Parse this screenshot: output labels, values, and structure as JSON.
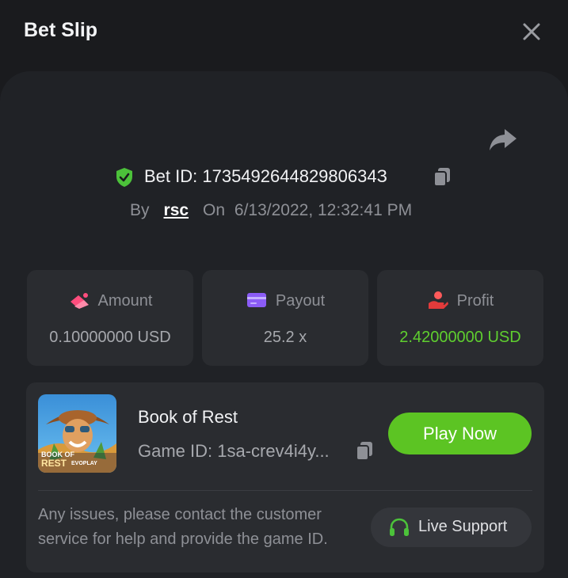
{
  "header": {
    "title": "Bet Slip"
  },
  "bet": {
    "id_text": "Bet ID: 173549264482980634З",
    "by_label": "By",
    "user": "rsc",
    "on_label": "On",
    "datetime": "6/13/2022, 12:32:41 PM"
  },
  "stats": {
    "amount": {
      "label": "Amount",
      "value": "0.10000000 USD",
      "icon": "coins-icon",
      "color": "#ff4d7d"
    },
    "payout": {
      "label": "Payout",
      "value": "25.2 x",
      "icon": "card-icon",
      "color": "#8b5cf6"
    },
    "profit": {
      "label": "Profit",
      "value": "2.42000000 USD",
      "icon": "hand-coin-icon",
      "color": "#5fcf2f"
    }
  },
  "game": {
    "name": "Book of Rest",
    "id_text": "Game ID: 1sa-crev4i4y...",
    "thumb_text_1": "BOOK OF",
    "thumb_text_2": "REST",
    "thumb_brand": "EVOPLAY",
    "play_label": "Play Now",
    "issues_text": "Any issues, please contact the customer service for help and provide the game ID.",
    "support_label": "Live Support"
  },
  "colors": {
    "accent_green": "#5cc423",
    "background": "#1a1b1e",
    "panel": "#202226",
    "card": "#2a2c30"
  }
}
